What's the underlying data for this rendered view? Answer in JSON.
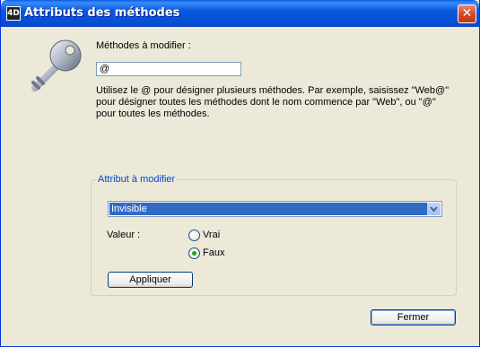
{
  "window": {
    "title": "Attributs des méthodes",
    "app_icon_text": "4D"
  },
  "methods": {
    "label": "Méthodes à modifier :",
    "value": "@",
    "help": "Utilisez le @ pour désigner plusieurs méthodes. Par exemple, saisissez \"Web@\" pour désigner toutes les méthodes dont le nom commence par \"Web\", ou \"@\" pour toutes les méthodes."
  },
  "attribute": {
    "group_title": "Attribut à modifier",
    "selected": "Invisible",
    "value_label": "Valeur :",
    "options": [
      {
        "label": "Vrai",
        "checked": false
      },
      {
        "label": "Faux",
        "checked": true
      }
    ],
    "apply_label": "Appliquer"
  },
  "footer": {
    "close_label": "Fermer"
  },
  "colors": {
    "titlebar": "#0552d8",
    "selection": "#316ac5",
    "group_title": "#0046d5",
    "face": "#ece9d8"
  }
}
